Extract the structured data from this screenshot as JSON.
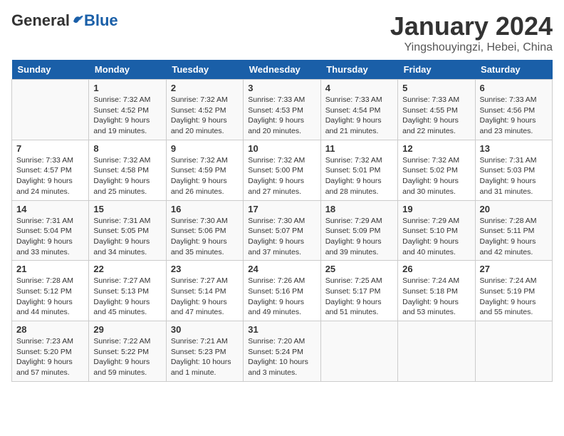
{
  "header": {
    "logo_general": "General",
    "logo_blue": "Blue",
    "month_title": "January 2024",
    "location": "Yingshouyingzi, Hebei, China"
  },
  "weekdays": [
    "Sunday",
    "Monday",
    "Tuesday",
    "Wednesday",
    "Thursday",
    "Friday",
    "Saturday"
  ],
  "weeks": [
    [
      {
        "day": "",
        "info": ""
      },
      {
        "day": "1",
        "info": "Sunrise: 7:32 AM\nSunset: 4:52 PM\nDaylight: 9 hours\nand 19 minutes."
      },
      {
        "day": "2",
        "info": "Sunrise: 7:32 AM\nSunset: 4:52 PM\nDaylight: 9 hours\nand 20 minutes."
      },
      {
        "day": "3",
        "info": "Sunrise: 7:33 AM\nSunset: 4:53 PM\nDaylight: 9 hours\nand 20 minutes."
      },
      {
        "day": "4",
        "info": "Sunrise: 7:33 AM\nSunset: 4:54 PM\nDaylight: 9 hours\nand 21 minutes."
      },
      {
        "day": "5",
        "info": "Sunrise: 7:33 AM\nSunset: 4:55 PM\nDaylight: 9 hours\nand 22 minutes."
      },
      {
        "day": "6",
        "info": "Sunrise: 7:33 AM\nSunset: 4:56 PM\nDaylight: 9 hours\nand 23 minutes."
      }
    ],
    [
      {
        "day": "7",
        "info": "Sunrise: 7:33 AM\nSunset: 4:57 PM\nDaylight: 9 hours\nand 24 minutes."
      },
      {
        "day": "8",
        "info": "Sunrise: 7:32 AM\nSunset: 4:58 PM\nDaylight: 9 hours\nand 25 minutes."
      },
      {
        "day": "9",
        "info": "Sunrise: 7:32 AM\nSunset: 4:59 PM\nDaylight: 9 hours\nand 26 minutes."
      },
      {
        "day": "10",
        "info": "Sunrise: 7:32 AM\nSunset: 5:00 PM\nDaylight: 9 hours\nand 27 minutes."
      },
      {
        "day": "11",
        "info": "Sunrise: 7:32 AM\nSunset: 5:01 PM\nDaylight: 9 hours\nand 28 minutes."
      },
      {
        "day": "12",
        "info": "Sunrise: 7:32 AM\nSunset: 5:02 PM\nDaylight: 9 hours\nand 30 minutes."
      },
      {
        "day": "13",
        "info": "Sunrise: 7:31 AM\nSunset: 5:03 PM\nDaylight: 9 hours\nand 31 minutes."
      }
    ],
    [
      {
        "day": "14",
        "info": "Sunrise: 7:31 AM\nSunset: 5:04 PM\nDaylight: 9 hours\nand 33 minutes."
      },
      {
        "day": "15",
        "info": "Sunrise: 7:31 AM\nSunset: 5:05 PM\nDaylight: 9 hours\nand 34 minutes."
      },
      {
        "day": "16",
        "info": "Sunrise: 7:30 AM\nSunset: 5:06 PM\nDaylight: 9 hours\nand 35 minutes."
      },
      {
        "day": "17",
        "info": "Sunrise: 7:30 AM\nSunset: 5:07 PM\nDaylight: 9 hours\nand 37 minutes."
      },
      {
        "day": "18",
        "info": "Sunrise: 7:29 AM\nSunset: 5:09 PM\nDaylight: 9 hours\nand 39 minutes."
      },
      {
        "day": "19",
        "info": "Sunrise: 7:29 AM\nSunset: 5:10 PM\nDaylight: 9 hours\nand 40 minutes."
      },
      {
        "day": "20",
        "info": "Sunrise: 7:28 AM\nSunset: 5:11 PM\nDaylight: 9 hours\nand 42 minutes."
      }
    ],
    [
      {
        "day": "21",
        "info": "Sunrise: 7:28 AM\nSunset: 5:12 PM\nDaylight: 9 hours\nand 44 minutes."
      },
      {
        "day": "22",
        "info": "Sunrise: 7:27 AM\nSunset: 5:13 PM\nDaylight: 9 hours\nand 45 minutes."
      },
      {
        "day": "23",
        "info": "Sunrise: 7:27 AM\nSunset: 5:14 PM\nDaylight: 9 hours\nand 47 minutes."
      },
      {
        "day": "24",
        "info": "Sunrise: 7:26 AM\nSunset: 5:16 PM\nDaylight: 9 hours\nand 49 minutes."
      },
      {
        "day": "25",
        "info": "Sunrise: 7:25 AM\nSunset: 5:17 PM\nDaylight: 9 hours\nand 51 minutes."
      },
      {
        "day": "26",
        "info": "Sunrise: 7:24 AM\nSunset: 5:18 PM\nDaylight: 9 hours\nand 53 minutes."
      },
      {
        "day": "27",
        "info": "Sunrise: 7:24 AM\nSunset: 5:19 PM\nDaylight: 9 hours\nand 55 minutes."
      }
    ],
    [
      {
        "day": "28",
        "info": "Sunrise: 7:23 AM\nSunset: 5:20 PM\nDaylight: 9 hours\nand 57 minutes."
      },
      {
        "day": "29",
        "info": "Sunrise: 7:22 AM\nSunset: 5:22 PM\nDaylight: 9 hours\nand 59 minutes."
      },
      {
        "day": "30",
        "info": "Sunrise: 7:21 AM\nSunset: 5:23 PM\nDaylight: 10 hours\nand 1 minute."
      },
      {
        "day": "31",
        "info": "Sunrise: 7:20 AM\nSunset: 5:24 PM\nDaylight: 10 hours\nand 3 minutes."
      },
      {
        "day": "",
        "info": ""
      },
      {
        "day": "",
        "info": ""
      },
      {
        "day": "",
        "info": ""
      }
    ]
  ]
}
